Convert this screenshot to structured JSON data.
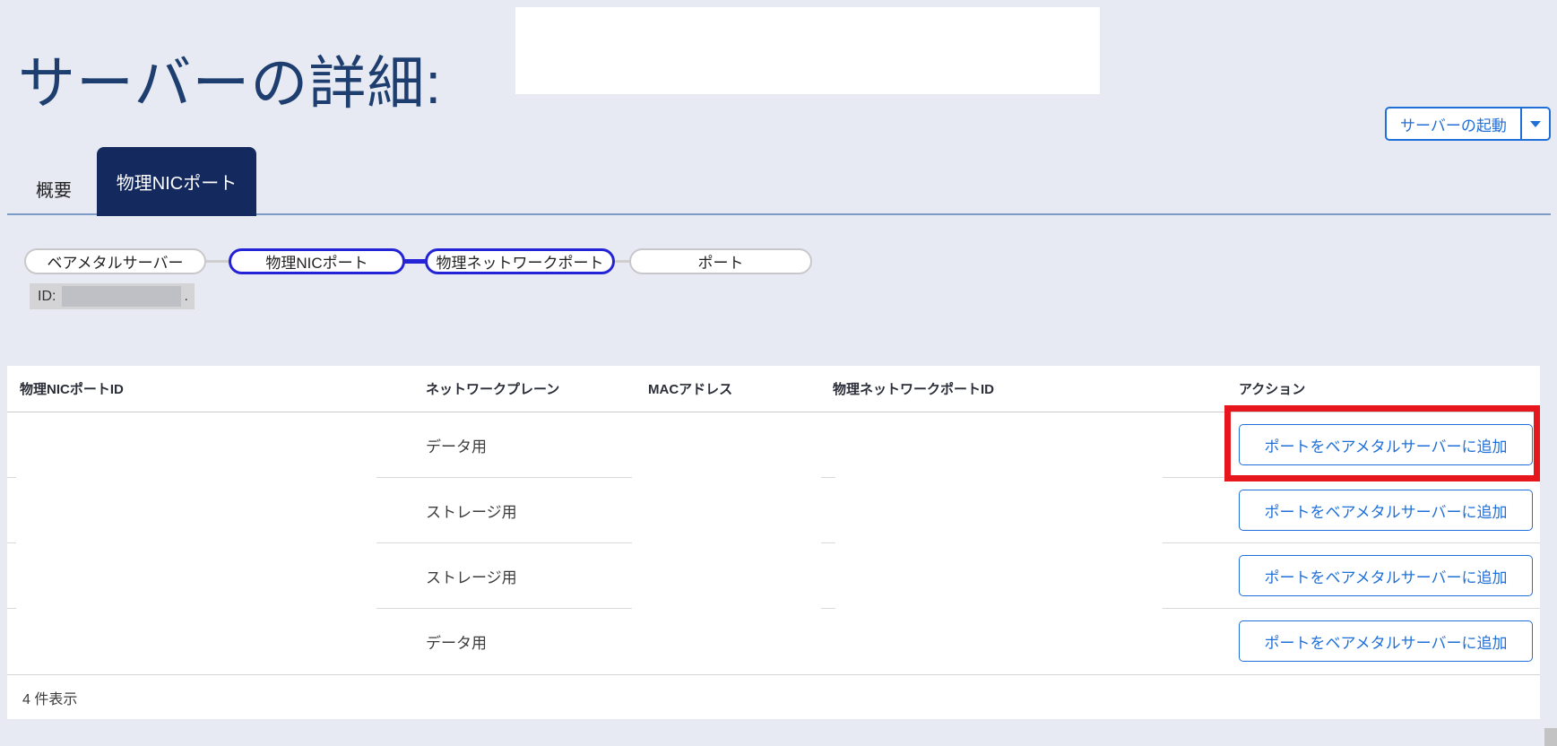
{
  "page": {
    "title": "サーバーの詳細:"
  },
  "actions": {
    "launch_button": "サーバーの起動",
    "caret_icon": "chevron-down"
  },
  "tabs": [
    {
      "label": "概要",
      "active": false
    },
    {
      "label": "物理NICポート",
      "active": true
    }
  ],
  "flow_nodes": [
    {
      "label": "ベアメタルサーバー",
      "selected": false
    },
    {
      "label": "物理NICポート",
      "selected": true
    },
    {
      "label": "物理ネットワークポート",
      "selected": true
    },
    {
      "label": "ポート",
      "selected": false
    }
  ],
  "id_badge": {
    "label": "ID:",
    "suffix": "."
  },
  "table": {
    "columns": [
      "物理NICポートID",
      "ネットワークプレーン",
      "MACアドレス",
      "物理ネットワークポートID",
      "アクション"
    ],
    "rows": [
      {
        "network_plane": "データ用",
        "action": "ポートをベアメタルサーバーに追加",
        "highlighted": true
      },
      {
        "network_plane": "ストレージ用",
        "action": "ポートをベアメタルサーバーに追加",
        "highlighted": false
      },
      {
        "network_plane": "ストレージ用",
        "action": "ポートをベアメタルサーバーに追加",
        "highlighted": false
      },
      {
        "network_plane": "データ用",
        "action": "ポートをベアメタルサーバーに追加",
        "highlighted": false
      }
    ],
    "footer": "4 件表示"
  },
  "colors": {
    "page_background": "#e8eaf3",
    "navy": "#142a5e",
    "title_navy": "#1d3e6f",
    "accent_blue": "#1f6fd8",
    "flow_blue": "#2424d6",
    "highlight_red": "#e6161c",
    "tab_underline": "#7d9bc7"
  }
}
